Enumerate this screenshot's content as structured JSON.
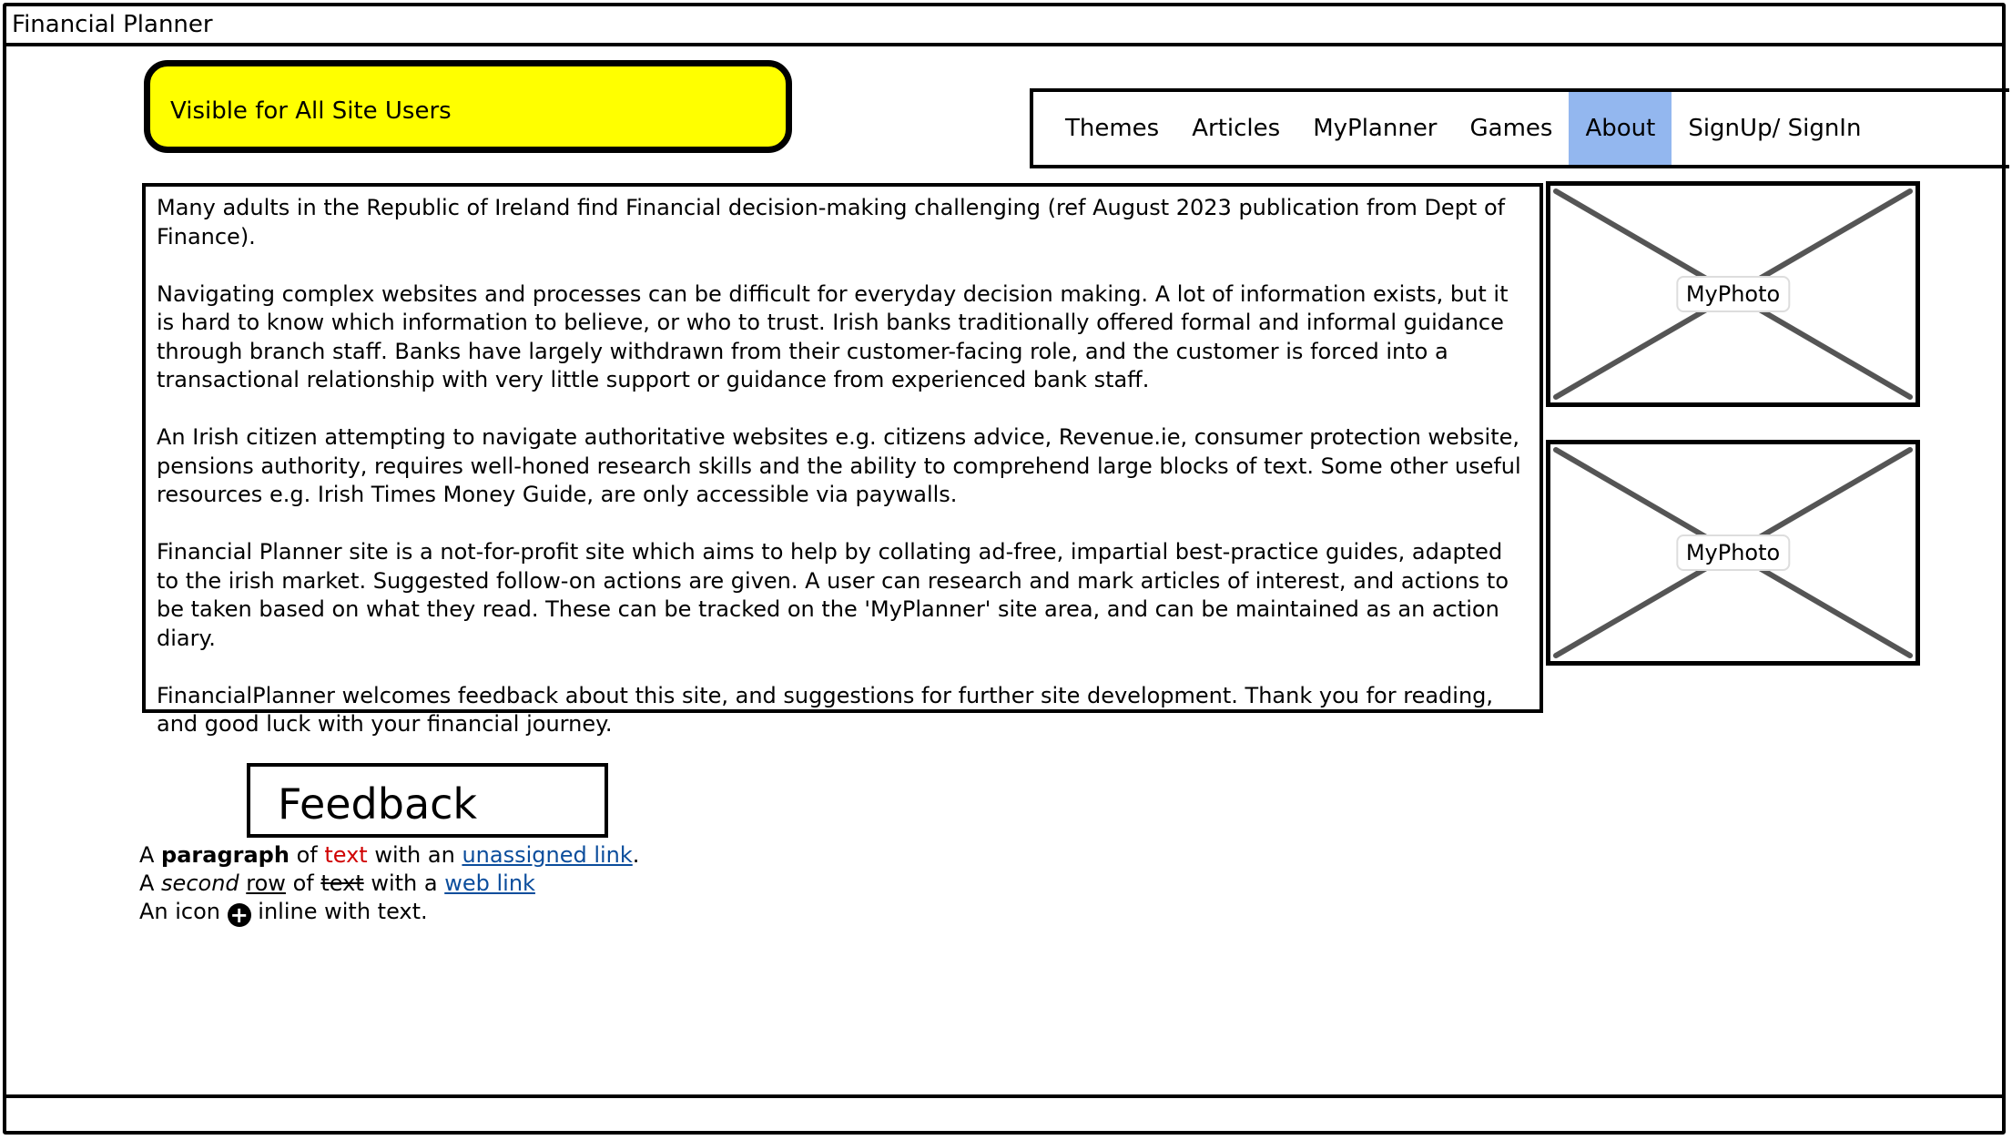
{
  "app": {
    "title": "Financial Planner"
  },
  "sticky_note": {
    "text": "Visible for All Site Users",
    "color": "#ffff00"
  },
  "nav": {
    "items": [
      {
        "label": "Themes"
      },
      {
        "label": "Articles"
      },
      {
        "label": "MyPlanner"
      },
      {
        "label": "Games"
      },
      {
        "label": "About"
      },
      {
        "label": "SignUp/ SignIn"
      }
    ],
    "active": "About",
    "active_color": "#93b7ef"
  },
  "content": {
    "paragraphs": [
      "Many adults in the Republic of Ireland find Financial decision-making challenging (ref August 2023 publication from Dept of Finance).",
      "Navigating complex websites and processes can be difficult for everyday decision making.  A lot of information exists, but it is hard to know which information to believe, or who to trust.  Irish banks traditionally offered formal and informal guidance through branch staff.  Banks have largely withdrawn from their customer-facing role, and the customer is forced into a transactional relationship with very little support or guidance from experienced bank staff.",
      "An Irish citizen attempting to navigate authoritative websites e.g. citizens advice,  Revenue.ie, consumer protection website, pensions authority, requires well-honed research skills and the ability to comprehend large blocks of text.   Some other useful resources e.g. Irish Times Money Guide, are only accessible via paywalls.",
      "Financial Planner site is a not-for-profit site which aims to help by collating ad-free, impartial best-practice guides, adapted to the irish market.  Suggested follow-on actions are given.  A user can research and mark articles of interest, and actions to be taken based on what they read.  These can be tracked on the 'MyPlanner' site area, and can be maintained as an action diary.",
      "FinancialPlanner welcomes feedback about this site, and suggestions for further site development.  Thank you for reading, and good luck with your financial journey."
    ]
  },
  "photos": [
    {
      "label": "MyPhoto"
    },
    {
      "label": "MyPhoto"
    }
  ],
  "feedback": {
    "label": "Feedback"
  },
  "sample_text": {
    "line1": {
      "a": "A ",
      "bold": "paragraph",
      "of": " of ",
      "red": "text",
      "with": " with an ",
      "link": "unassigned link",
      "end": "."
    },
    "line2": {
      "a": "A ",
      "italic": "second",
      "sp": " ",
      "underline": "row",
      "of": " of ",
      "strike": "text",
      "with": " with a ",
      "link": "web link"
    },
    "line3": {
      "a": "An icon ",
      "icon": "plus-circle-icon",
      "end": " inline with text."
    }
  }
}
